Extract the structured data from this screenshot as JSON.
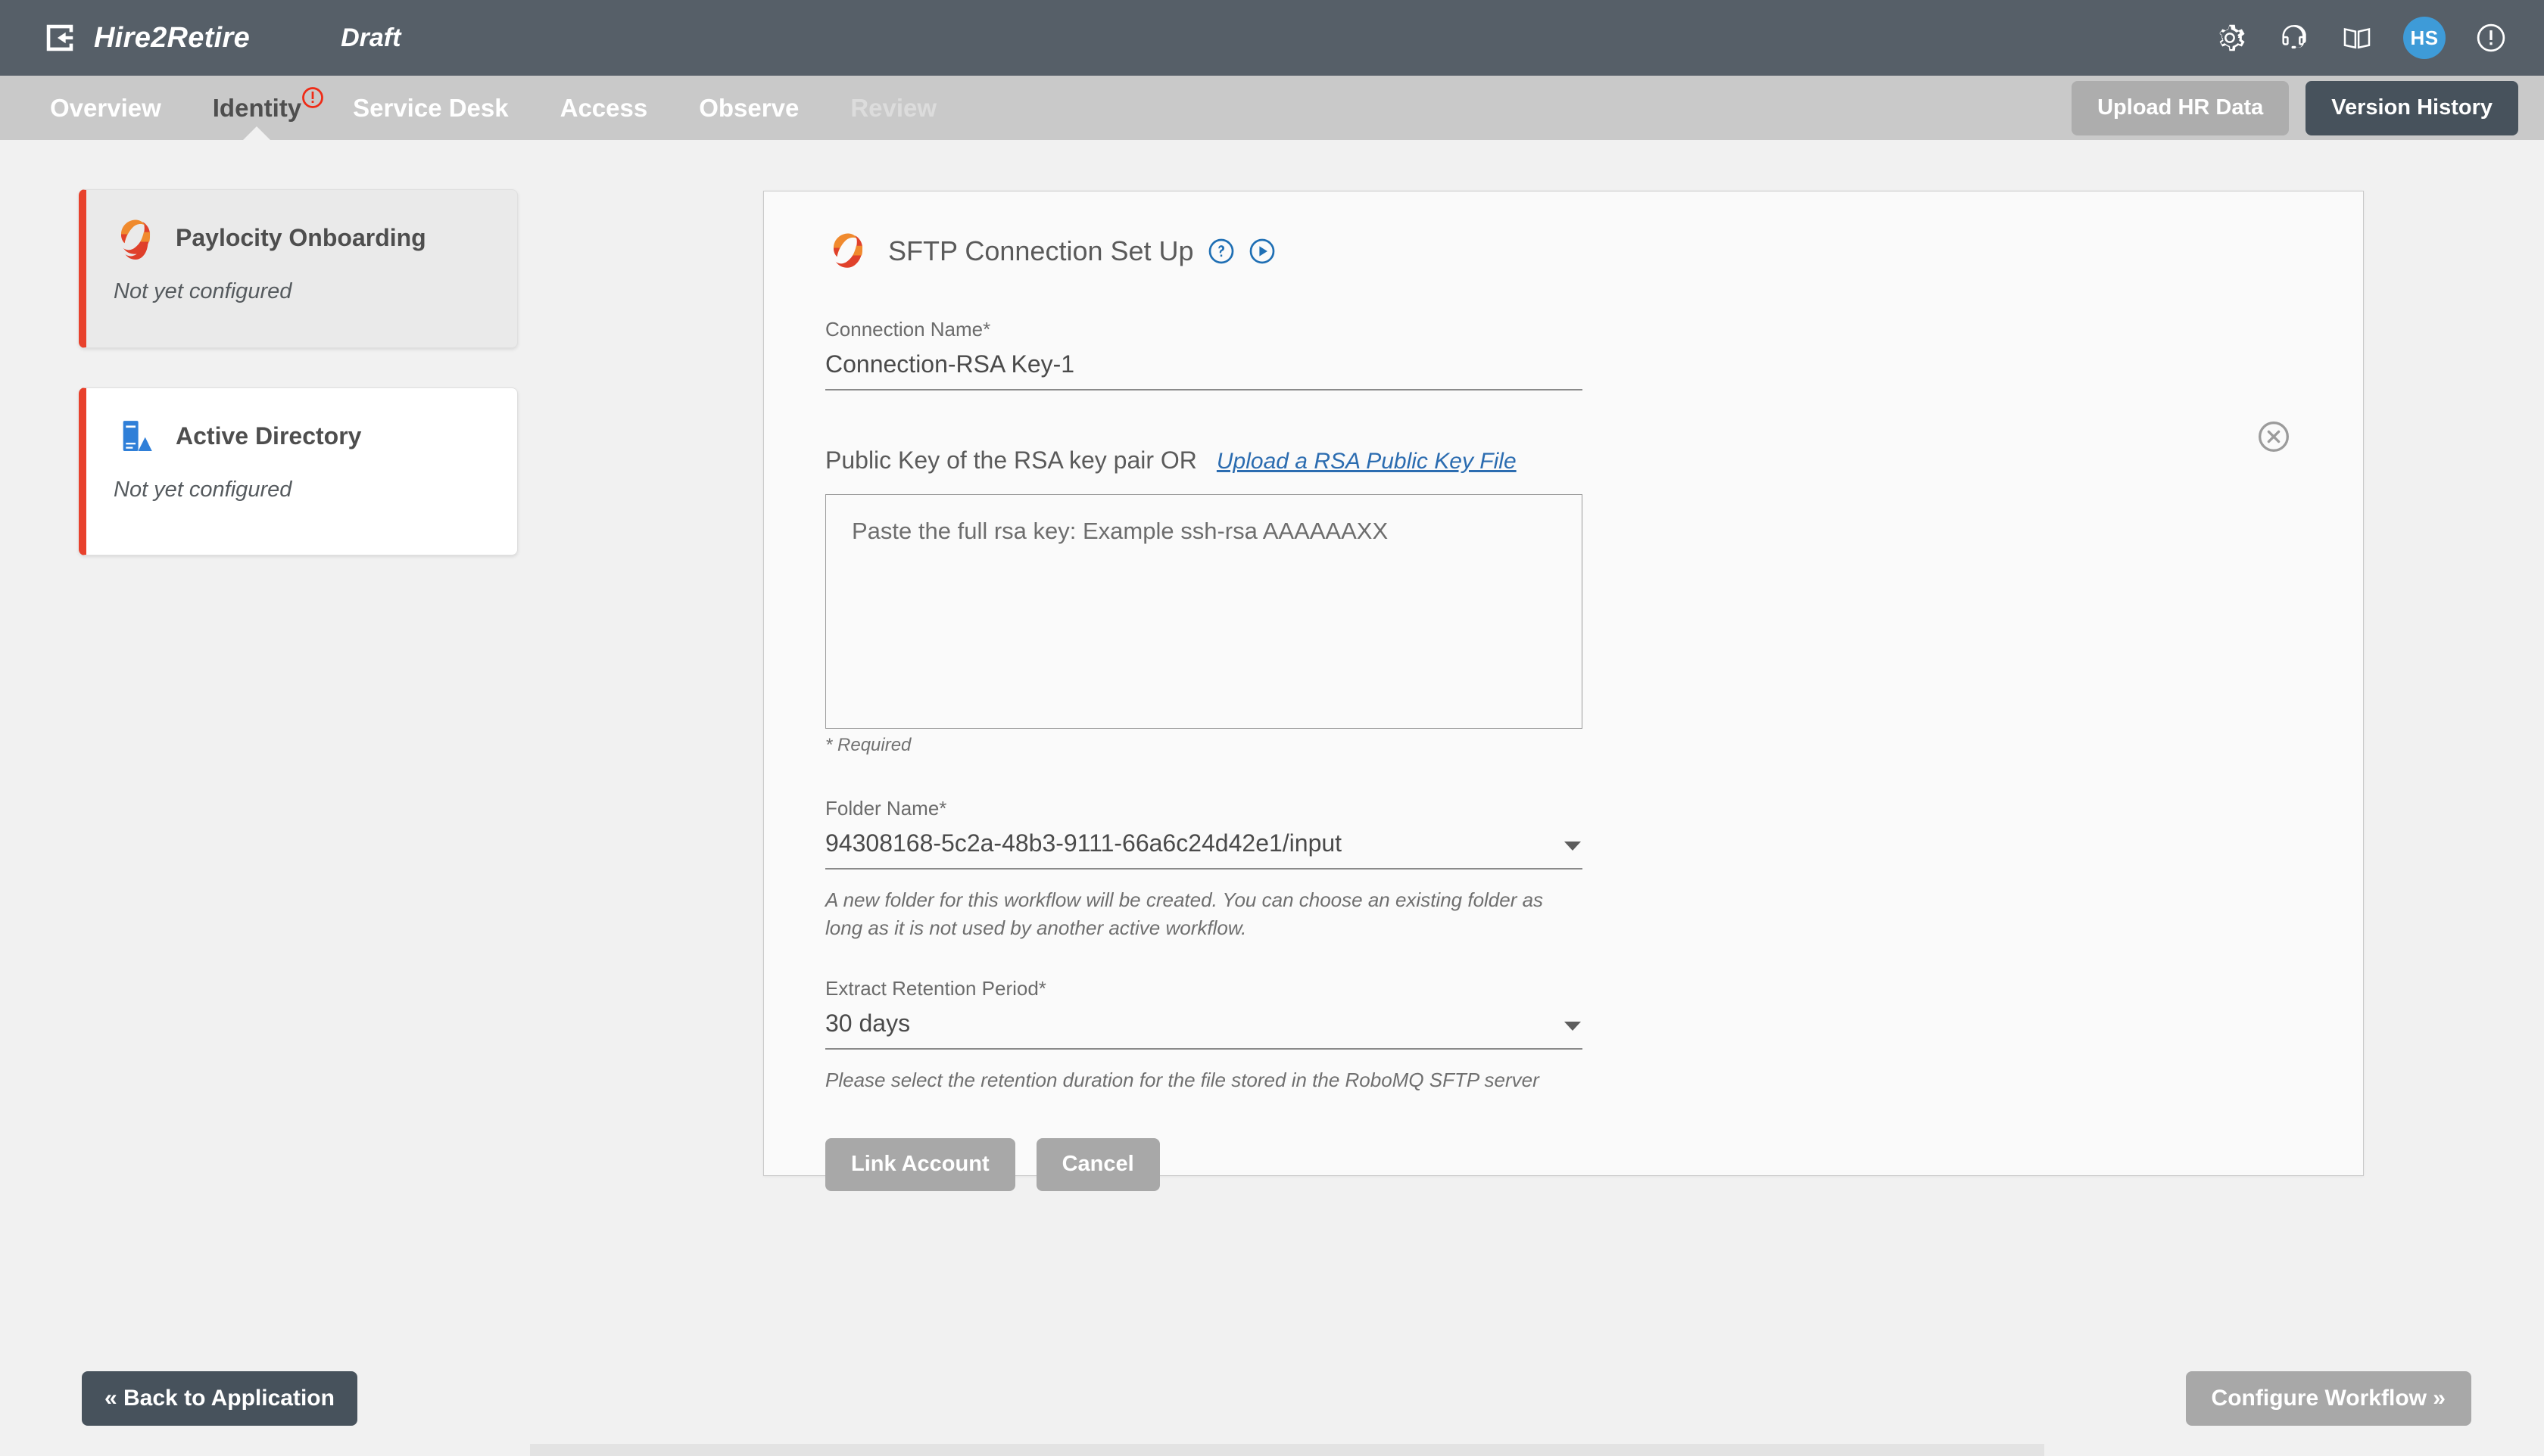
{
  "topbar": {
    "back_icon": "exit-arrow-icon",
    "brand": "Hire2Retire",
    "status": "Draft",
    "icons": [
      "gear-icon",
      "headset-icon",
      "book-icon"
    ],
    "avatar_initials": "HS",
    "alert_icon": "exclamation-circle-icon"
  },
  "nav": {
    "items": [
      {
        "label": "Overview",
        "state": "normal"
      },
      {
        "label": "Identity",
        "state": "active",
        "badge": "exclamation-badge"
      },
      {
        "label": "Service Desk",
        "state": "normal"
      },
      {
        "label": "Access",
        "state": "normal"
      },
      {
        "label": "Observe",
        "state": "normal"
      },
      {
        "label": "Review",
        "state": "disabled"
      }
    ],
    "upload_hr_data": "Upload HR Data",
    "version_history": "Version History"
  },
  "sidebar": {
    "cards": [
      {
        "title": "Paylocity Onboarding",
        "status": "Not yet configured",
        "icon": "paylocity-logo-icon",
        "selected": true
      },
      {
        "title": "Active Directory",
        "status": "Not yet configured",
        "icon": "active-directory-icon",
        "selected": false
      }
    ]
  },
  "panel": {
    "logo": "paylocity-logo-icon",
    "title": "SFTP Connection Set Up",
    "help_icon": "question-circle-icon",
    "play_icon": "play-circle-icon",
    "close_icon": "close-circle-icon",
    "connection_name": {
      "label": "Connection Name*",
      "value": "Connection-RSA Key-1"
    },
    "public_key": {
      "label": "Public Key of the RSA key pair OR",
      "link": "Upload a RSA Public Key File",
      "placeholder": "Paste the full rsa key: Example ssh-rsa AAAAAAXX",
      "value": "",
      "required_note": "* Required"
    },
    "folder_name": {
      "label": "Folder Name*",
      "value": "94308168-5c2a-48b3-9111-66a6c24d42e1/input",
      "helper": "A new folder for this workflow will be created. You can choose an existing folder as long as it is not used by another active workflow."
    },
    "retention": {
      "label": "Extract Retention Period*",
      "value": "30 days",
      "helper": "Please select the retention duration for the file stored in the RoboMQ SFTP server"
    },
    "link_account": "Link Account",
    "cancel": "Cancel"
  },
  "footer": {
    "back": "« Back to Application",
    "configure": "Configure Workflow »"
  },
  "colors": {
    "topbar": "#565f68",
    "navbar": "#c9c9c9",
    "accent_red": "#e8412c",
    "link_blue": "#2b6cb0",
    "avatar_blue": "#3e9bd8",
    "dark_button": "#47525c",
    "gray_button": "#a8a8a8"
  }
}
